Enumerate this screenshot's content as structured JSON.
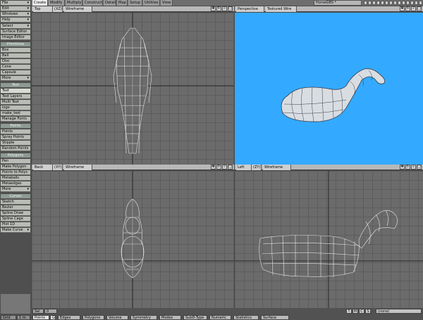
{
  "menu_tabs": [
    "Create",
    "Modify",
    "Multiply",
    "Construct",
    "Detail",
    "Map",
    "Setup",
    "Utilities",
    "View"
  ],
  "scene_name": "HorseGBS *",
  "sidebar": {
    "top_menu": [
      "File",
      "Edit",
      "Windows",
      "Help"
    ],
    "tools": [
      "Select",
      "Surface Editor",
      "Image Editor"
    ],
    "sections": [
      {
        "title": "Primitives",
        "items": [
          "Box",
          "Ball",
          "Disc",
          "Cone",
          "Capsule",
          "More"
        ]
      },
      {
        "title": "Text",
        "items": [
          "Text",
          "Text Layers",
          "Multi Text",
          "logo",
          "make_text",
          "Manage Fonts"
        ]
      },
      {
        "title": "Points",
        "items": [
          "Points",
          "Spray Points",
          "Stipple",
          "Random Points"
        ]
      },
      {
        "title": "Polygons",
        "items": [
          "Pen",
          "Make Polygon",
          "Points to Polys",
          "Metaballs",
          "Metaedges",
          "More"
        ]
      },
      {
        "title": "Curves",
        "items": [
          "Sketch",
          "Bezier",
          "Spline Draw",
          "Spline Cage",
          "Plot 1D",
          "Make Curve"
        ]
      }
    ],
    "grid_label": "Grid",
    "grid_value": "1 m"
  },
  "viewports": [
    {
      "view": "Top",
      "axis": "(XZ)",
      "mode": "Wireframe"
    },
    {
      "view": "Perspective",
      "axis": "",
      "mode": "Textured Wire"
    },
    {
      "view": "Back",
      "axis": "(XY)",
      "mode": "Wireframe"
    },
    {
      "view": "Left",
      "axis": "(ZY)",
      "mode": "Wireframe"
    }
  ],
  "viewport_icons": [
    "move-icon",
    "rotate-icon",
    "zoom-icon",
    "maximize-icon"
  ],
  "colors": {
    "perspective_bg": "#33aaff",
    "wire": "#e8e8e8",
    "grid": "#6b6b6b"
  },
  "bottom": {
    "sel_label": "Sel",
    "sel_value": "0",
    "tabs": [
      "Points",
      "Edges",
      "Polygons",
      "Volume",
      "Symmetry",
      "Modes",
      "SubD-Type",
      "Numeric",
      "Statistics",
      "Surface"
    ],
    "tab_suffix": "G",
    "view_buttons": [
      "T",
      "M",
      "C",
      "S"
    ],
    "surface_value": "(none)"
  }
}
